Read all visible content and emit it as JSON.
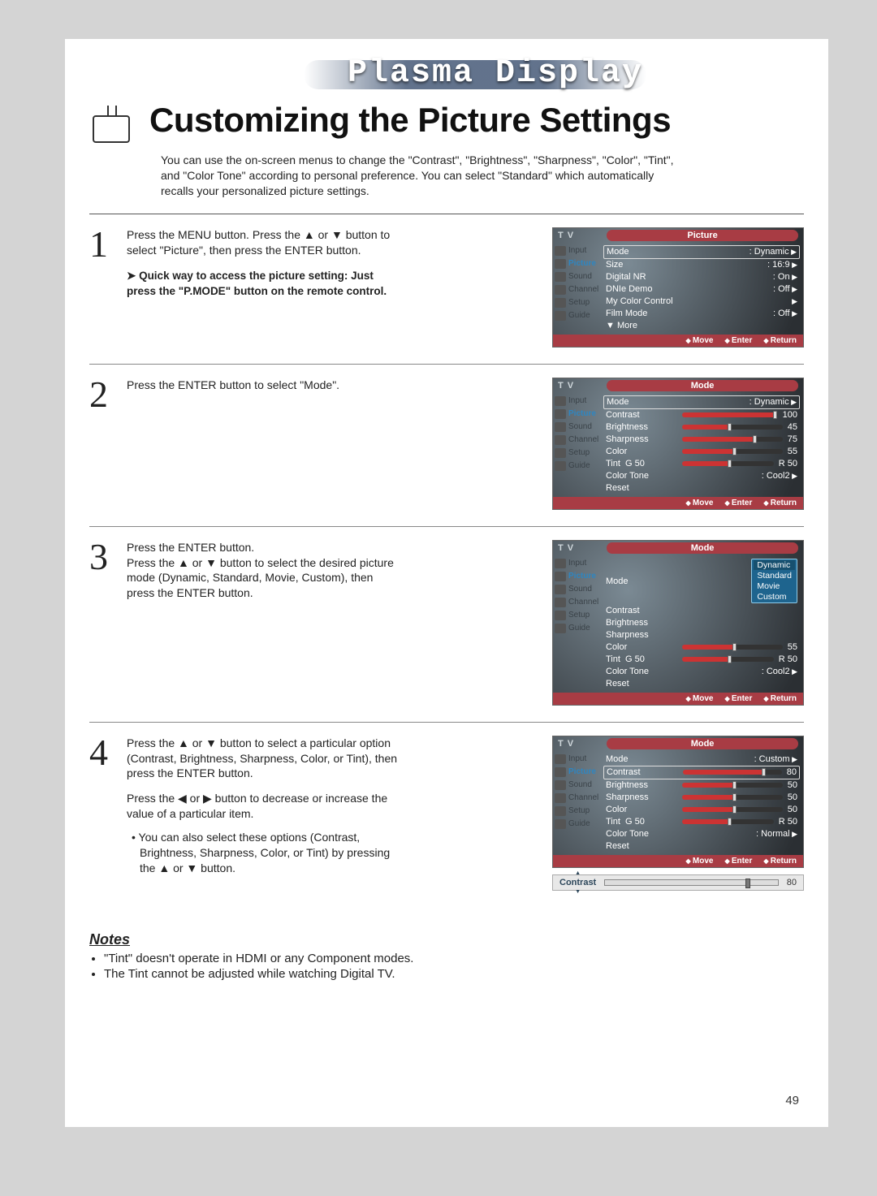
{
  "banner": "Plasma Display",
  "title": "Customizing the Picture Settings",
  "intro": "You can use the on-screen menus to change the \"Contrast\", \"Brightness\", \"Sharpness\", \"Color\", \"Tint\", and \"Color Tone\" according to personal preference. You can select \"Standard\" which automatically recalls your personalized picture settings.",
  "page_number": "49",
  "steps": {
    "s1": {
      "num": "1",
      "text": "Press the MENU button. Press the ▲ or ▼ button to select \"Picture\", then press the ENTER button.",
      "hint": "Quick way to access the picture setting: Just press the \"P.MODE\" button on the remote control."
    },
    "s2": {
      "num": "2",
      "text": "Press the ENTER button to select \"Mode\"."
    },
    "s3": {
      "num": "3",
      "text1": "Press the ENTER button.",
      "text2": "Press the ▲ or ▼ button to select the desired picture mode (Dynamic, Standard, Movie, Custom), then press the ENTER button."
    },
    "s4": {
      "num": "4",
      "text1": "Press the ▲ or ▼ button to select a particular option (Contrast, Brightness, Sharpness, Color, or Tint), then press the ENTER button.",
      "text2": "Press the ◀ or ▶ button to decrease or increase the value of a particular item.",
      "bullet": "You can also select these options (Contrast, Brightness, Sharpness, Color, or Tint) by pressing the ▲ or ▼ button."
    }
  },
  "notes": {
    "heading": "Notes",
    "items": [
      "\"Tint\" doesn't operate in HDMI or any Component modes.",
      "The Tint cannot be adjusted while watching Digital TV."
    ]
  },
  "osd": {
    "tv": "T V",
    "side": [
      "Input",
      "Picture",
      "Sound",
      "Channel",
      "Setup",
      "Guide"
    ],
    "footer": {
      "move": "Move",
      "enter": "Enter",
      "return": "Return"
    },
    "picture": {
      "title": "Picture",
      "rows": [
        {
          "label": "Mode",
          "val": ": Dynamic",
          "arw": true,
          "boxed": true
        },
        {
          "label": "Size",
          "val": ": 16:9",
          "arw": true
        },
        {
          "label": "Digital NR",
          "val": ": On",
          "arw": true
        },
        {
          "label": "DNIe Demo",
          "val": ": Off",
          "arw": true
        },
        {
          "label": "My Color Control",
          "val": "",
          "arw": true
        },
        {
          "label": "Film Mode",
          "val": ": Off",
          "arw": true
        },
        {
          "label": "▼ More",
          "val": ""
        }
      ]
    },
    "mode2": {
      "title": "Mode",
      "rows": [
        {
          "label": "Mode",
          "val": ": Dynamic",
          "boxed": true,
          "arw": true
        },
        {
          "label": "Contrast",
          "slider": true,
          "val": "100",
          "pct": 95
        },
        {
          "label": "Brightness",
          "slider": true,
          "val": "45",
          "pct": 45
        },
        {
          "label": "Sharpness",
          "slider": true,
          "val": "75",
          "pct": 70
        },
        {
          "label": "Color",
          "slider": true,
          "val": "55",
          "pct": 50
        },
        {
          "label": "Tint",
          "tint": "G 50",
          "val": "R 50",
          "slider": true,
          "pct": 50
        },
        {
          "label": "Color Tone",
          "val": ": Cool2",
          "arw": true
        },
        {
          "label": "Reset"
        }
      ]
    },
    "mode3": {
      "title": "Mode",
      "dropdown": [
        "Dynamic",
        "Standard",
        "Movie",
        "Custom"
      ],
      "rows": [
        {
          "label": "Mode",
          "dd": true
        },
        {
          "label": "Contrast"
        },
        {
          "label": "Brightness"
        },
        {
          "label": "Sharpness"
        },
        {
          "label": "Color",
          "slider": true,
          "val": "55",
          "pct": 50
        },
        {
          "label": "Tint",
          "tint": "G 50",
          "val": "R 50",
          "slider": true,
          "pct": 50
        },
        {
          "label": "Color Tone",
          "val": ": Cool2",
          "arw": true
        },
        {
          "label": "Reset"
        }
      ]
    },
    "mode4": {
      "title": "Mode",
      "rows": [
        {
          "label": "Mode",
          "val": ": Custom",
          "arw": true
        },
        {
          "label": "Contrast",
          "slider": true,
          "val": "80",
          "boxed": true,
          "pct": 80
        },
        {
          "label": "Brightness",
          "slider": true,
          "val": "50",
          "pct": 50
        },
        {
          "label": "Sharpness",
          "slider": true,
          "val": "50",
          "pct": 50
        },
        {
          "label": "Color",
          "slider": true,
          "val": "50",
          "pct": 50
        },
        {
          "label": "Tint",
          "tint": "G 50",
          "val": "R 50",
          "slider": true,
          "pct": 50
        },
        {
          "label": "Color Tone",
          "val": ": Normal",
          "arw": true
        },
        {
          "label": "Reset"
        }
      ]
    },
    "contrast_strip": {
      "label": "Contrast",
      "val": "80",
      "pct": 80
    }
  }
}
